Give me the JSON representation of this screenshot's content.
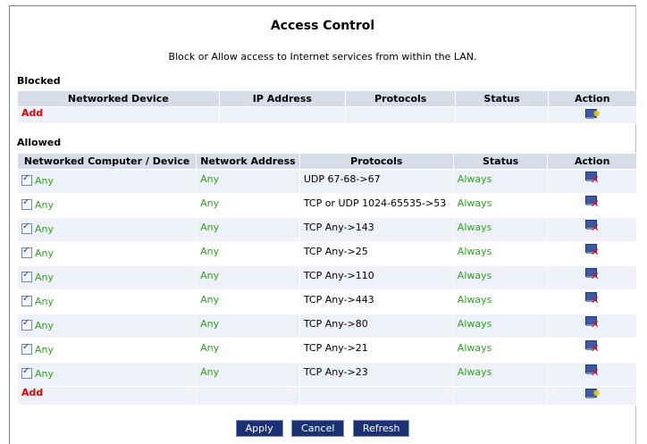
{
  "title": "Access Control",
  "subtitle": "Block or Allow access to Internet services from within the LAN.",
  "blocked": {
    "label": "Blocked",
    "headers": [
      "Networked Device",
      "IP Address",
      "Protocols",
      "Status",
      "Action"
    ],
    "add_label": "Add"
  },
  "allowed": {
    "label": "Allowed",
    "headers": [
      "Networked Computer / Device",
      "Network Address",
      "Protocols",
      "Status",
      "Action"
    ],
    "rows": [
      {
        "device": "Any",
        "address": "Any",
        "protocols": "UDP 67-68->67",
        "status": "Always",
        "checked": true
      },
      {
        "device": "Any",
        "address": "Any",
        "protocols": "TCP or UDP 1024-65535->53",
        "status": "Always",
        "checked": true
      },
      {
        "device": "Any",
        "address": "Any",
        "protocols": "TCP Any->143",
        "status": "Always",
        "checked": true
      },
      {
        "device": "Any",
        "address": "Any",
        "protocols": "TCP Any->25",
        "status": "Always",
        "checked": true
      },
      {
        "device": "Any",
        "address": "Any",
        "protocols": "TCP Any->110",
        "status": "Always",
        "checked": true
      },
      {
        "device": "Any",
        "address": "Any",
        "protocols": "TCP Any->443",
        "status": "Always",
        "checked": true
      },
      {
        "device": "Any",
        "address": "Any",
        "protocols": "TCP Any->80",
        "status": "Always",
        "checked": true
      },
      {
        "device": "Any",
        "address": "Any",
        "protocols": "TCP Any->21",
        "status": "Always",
        "checked": true
      },
      {
        "device": "Any",
        "address": "Any",
        "protocols": "TCP Any->23",
        "status": "Always",
        "checked": true
      }
    ],
    "add_label": "Add"
  },
  "buttons": {
    "apply": "Apply",
    "cancel": "Cancel",
    "refresh": "Refresh"
  },
  "icons": {
    "add": "computer-add-icon",
    "delete": "computer-delete-icon"
  },
  "colors": {
    "header_bg": "#d6dde8",
    "row_bg": "#eef1f7",
    "add_link": "#e00000",
    "allowed_text": "#2ea01e",
    "button_bg": "#1a3273"
  }
}
